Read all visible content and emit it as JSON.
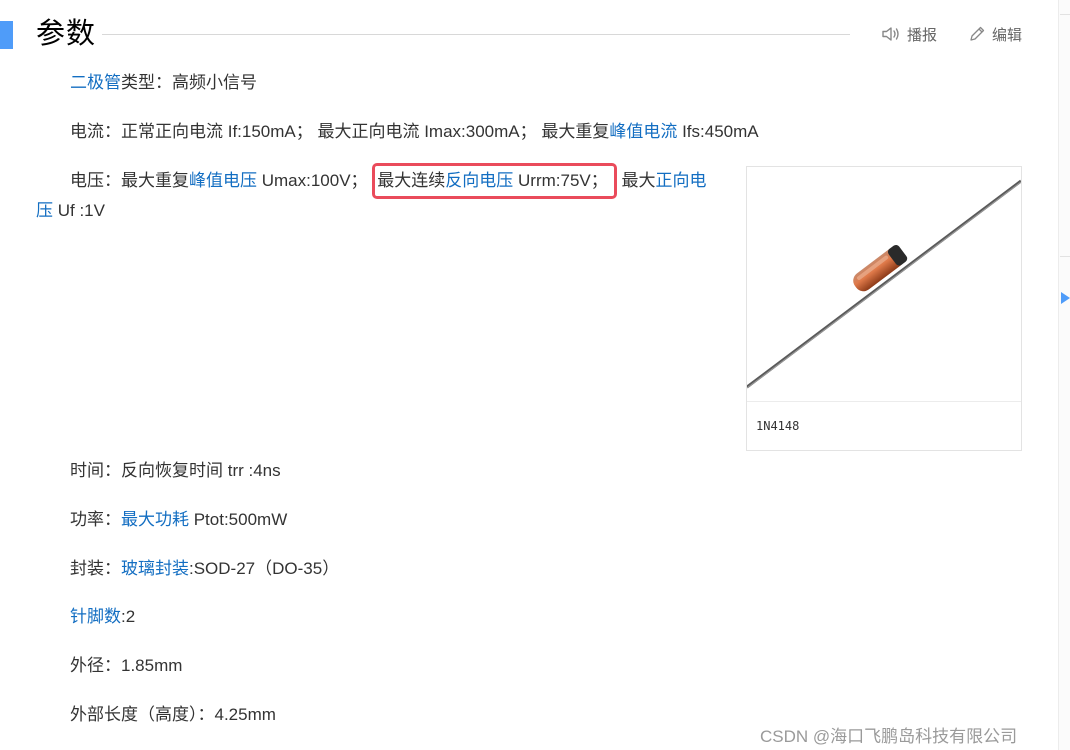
{
  "header": {
    "title": "参数",
    "actions": {
      "broadcast_label": "播报",
      "edit_label": "编辑"
    }
  },
  "params": {
    "type": {
      "link": "二极管",
      "rest": "类型：高频小信号"
    },
    "current": {
      "label": "电流：",
      "text1": "正常正向电流 If:150mA； 最大正向电流 Imax:300mA； 最大重复",
      "link1": "峰值电流",
      "text2": " Ifs:450mA"
    },
    "voltage": {
      "label": "电压：",
      "text1": "最大重复",
      "link1": "峰值电压",
      "text2": " Umax:100V；",
      "highlight_text": "最大连续",
      "highlight_link": "反向电压",
      "highlight_rest": " Urrm:75V；",
      "text3": " 最大",
      "link2_line1": "正向电",
      "link2_line2": "压",
      "text4": " Uf :1V"
    },
    "time": {
      "label": "时间：",
      "text": "反向恢复时间 trr :4ns"
    },
    "power": {
      "label": "功率：",
      "link": "最大功耗",
      "text": " Ptot:500mW"
    },
    "package": {
      "label": "封装：",
      "link": "玻璃封装",
      "text": ":SOD-27（DO-35）"
    },
    "pins": {
      "link": "针脚数",
      "text": ":2"
    },
    "diameter": {
      "label": "外径：",
      "text": "1.85mm"
    },
    "length": {
      "label": "外部长度（高度）：",
      "text": "4.25mm"
    }
  },
  "figure": {
    "caption": "1N4148"
  },
  "watermark": "CSDN @海口飞鹏岛科技有限公司",
  "colors": {
    "accent": "#4f9cf9",
    "link": "#136ec2",
    "highlight_border": "#ea4b5b",
    "text": "#333333"
  }
}
